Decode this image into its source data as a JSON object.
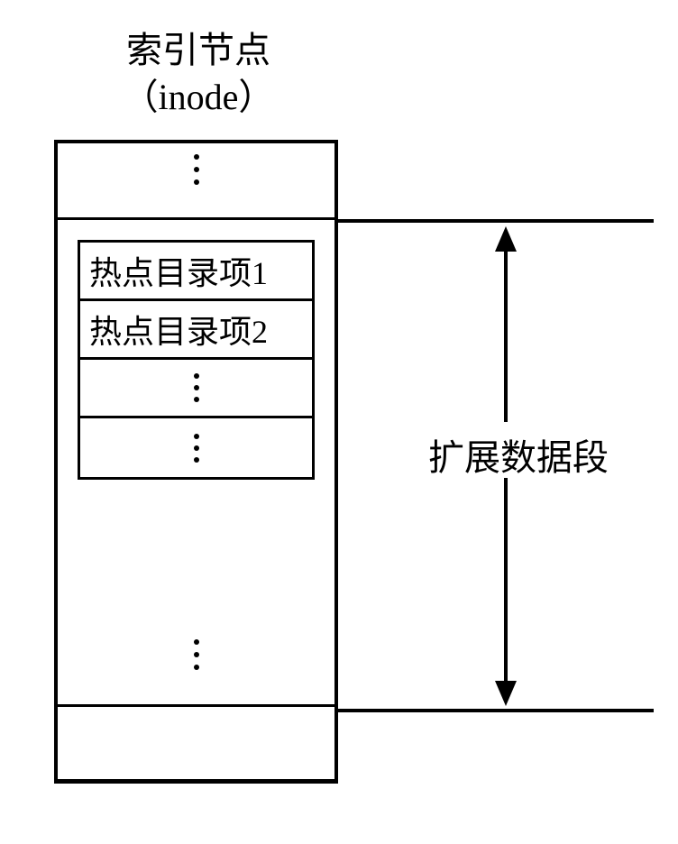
{
  "title": {
    "line1": "索引节点",
    "line2": "（inode）"
  },
  "entries": {
    "row1": "热点目录项1",
    "row2": "热点目录项2"
  },
  "annotation": {
    "right_label": "扩展数据段"
  }
}
